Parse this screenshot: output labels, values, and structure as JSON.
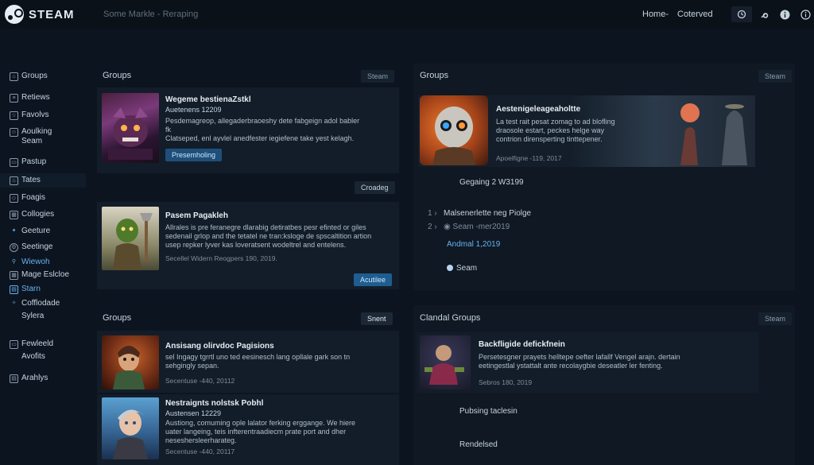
{
  "topbar": {
    "logo_text": "STEAM",
    "search_placeholder": "Some Markle - Reraping",
    "nav": [
      "Home-",
      "Coterved"
    ],
    "icons": [
      "clock-icon",
      "wrench-icon",
      "info-icon"
    ]
  },
  "sidebar": {
    "items": [
      {
        "label": "Groups",
        "icon": "home-icon"
      },
      {
        "label": "Retiews",
        "icon": "list-icon"
      },
      {
        "label": "Favolvs",
        "icon": "star-icon"
      },
      {
        "label": "Aoulking Seam",
        "icon": "people-icon"
      },
      {
        "label": "Pastup",
        "icon": "folder-icon"
      },
      {
        "label": "Tates",
        "icon": "home-icon"
      },
      {
        "label": "Foagis",
        "icon": "tag-icon"
      },
      {
        "label": "Collogies",
        "icon": "grid-icon"
      },
      {
        "label": "Geeture",
        "icon": "bird-icon"
      },
      {
        "label": "Seetinge",
        "icon": "gear-icon"
      },
      {
        "label": "Wiewoh",
        "icon": "search-icon"
      },
      {
        "label": "Mage Eslcloe",
        "icon": "grid-icon"
      },
      {
        "label": "Starn",
        "icon": "chart-icon"
      },
      {
        "label": "Cofflodade",
        "icon": "user-icon"
      },
      {
        "label": "Sylera",
        "icon": "none"
      },
      {
        "label": "Fewleeld",
        "icon": "folder-icon"
      },
      {
        "label": "Avofits",
        "icon": "none"
      },
      {
        "label": "Arahlys",
        "icon": "chart-icon"
      }
    ]
  },
  "left_top": {
    "title": "Groups",
    "tag": "Steam",
    "card1": {
      "title": "Wegeme bestienaZstkl",
      "sub": "Auetenens 12209",
      "desc": [
        "Pesdemagreop, allegaderbraoeshy dete fabgeign adol babler",
        "fk",
        "Clatseped, enl ayvlel anedfester iegiefene take yest kelagh."
      ],
      "button": "Presemholing"
    },
    "mid_button": "Croadeg",
    "card2": {
      "title": "Pasem Pagakleh",
      "desc": [
        "Allrales is pre feranegre dlarabig detiratbes pesr efinted or giles",
        "sedenail grlop and the tetatel ne tran:ksloge de spscaltition artion",
        "usep repker lyver kas loveratsent wodeltrel and entelens."
      ],
      "meta": "Secellel Widern Reogpers 190, 2019.",
      "button": "Acutilee"
    }
  },
  "right_top": {
    "title": "Groups",
    "tag": "Steam",
    "featured": {
      "title": "Aestenigeleageaholtte",
      "desc": [
        "La test rait pesat zomag to ad blofling",
        "draosole estart, peckes helge way",
        "contrion dirensperting tinttepener."
      ],
      "meta": "Apoelfigne -119, 2017"
    },
    "line1": "Gegaing 2 W3199",
    "list": [
      {
        "num": "1",
        "text": "Malsenerlette neg Piolge"
      },
      {
        "num": "2",
        "text": "Seam -mer2019"
      }
    ],
    "date": "Andmal 1,2019",
    "seam": "Seam"
  },
  "left_bottom": {
    "title": "Groups",
    "tag": "Snent",
    "card1": {
      "title": "Ansisang olirvdoc Pagisions",
      "desc": [
        "sel Ingagy tgrrtl uno ted eesinesch lang opllale gark son tn",
        "sehgingly sepan."
      ],
      "meta": "Secentuse -440, 20112"
    },
    "card2": {
      "title": "Nestraignts nolstsk Pobhl",
      "sub": "Austensen 12229",
      "desc": [
        "Austiong, comuming ople lalator ferking erggange. We hiere",
        "uater langeing, teis infterentraadiecm prate port and dher",
        "neseshersleerharateg."
      ],
      "meta": "Secentuse -440, 20117"
    }
  },
  "right_bottom": {
    "title": "Clandal Groups",
    "tag": "Steam",
    "card": {
      "title": "Backfligide defickfnein",
      "desc": [
        "Persetesgner prayets helltepe oefter lafallf Vengel arajn. dertain",
        "eetingestlal ystattalt ante recolaygbie deseatler ler fenting."
      ],
      "meta": "Sebros 180, 2019"
    },
    "line1": "Pubsing taclesin",
    "line2": "Rendelsed"
  },
  "colors": {
    "background": "#0c1420",
    "panel": "#0f1823",
    "accent_blue": "#66b3f0",
    "button_blue": "#1e4f7a"
  }
}
